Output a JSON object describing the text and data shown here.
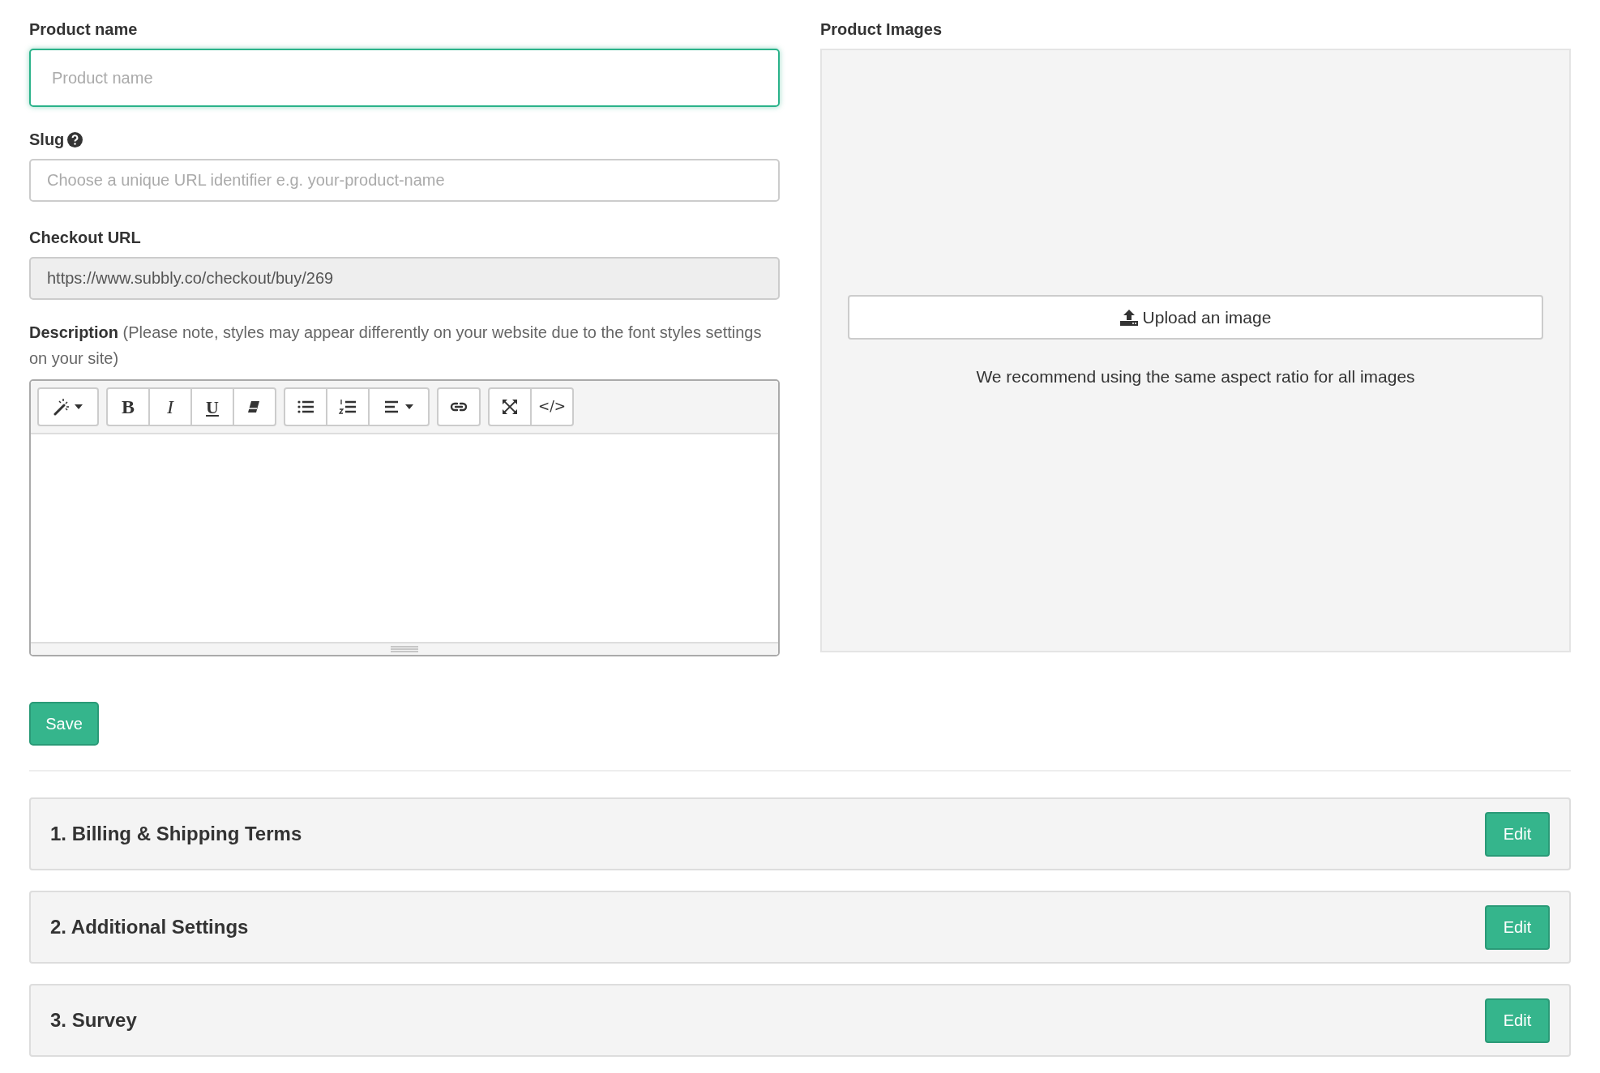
{
  "product_name": {
    "label": "Product name",
    "placeholder": "Product name",
    "focused": true
  },
  "slug": {
    "label": "Slug",
    "placeholder": "Choose a unique URL identifier e.g. your-product-name"
  },
  "checkout_url": {
    "label": "Checkout URL",
    "value": "https://www.subbly.co/checkout/buy/269",
    "disabled": true
  },
  "description": {
    "label": "**Description** (Please note, styles may appear differently on your website due to the font styles settings on your site)",
    "toolbar": [
      [
        {
          "kind": "magic",
          "dropdown": true
        }
      ],
      [
        {
          "kind": "bold",
          "glyph": "B"
        },
        {
          "kind": "italic",
          "glyph": "I"
        },
        {
          "kind": "underline",
          "glyph": "U"
        },
        {
          "kind": "eraser"
        }
      ],
      [
        {
          "kind": "bullets"
        },
        {
          "kind": "numbers"
        },
        {
          "kind": "align",
          "dropdown": true
        }
      ],
      [
        {
          "kind": "link"
        }
      ],
      [
        {
          "kind": "fullscreen"
        },
        {
          "kind": "code",
          "glyph": "</>"
        }
      ]
    ]
  },
  "save_button": "Save",
  "product_images": {
    "label": "Product Images",
    "upload_button": "Upload an image",
    "hint": "We recommend using the same aspect ratio for all images"
  },
  "sections": [
    {
      "title": "1. Billing & Shipping Terms",
      "button": "Edit"
    },
    {
      "title": "2. Additional Settings",
      "button": "Edit"
    },
    {
      "title": "3. Survey",
      "button": "Edit"
    }
  ]
}
